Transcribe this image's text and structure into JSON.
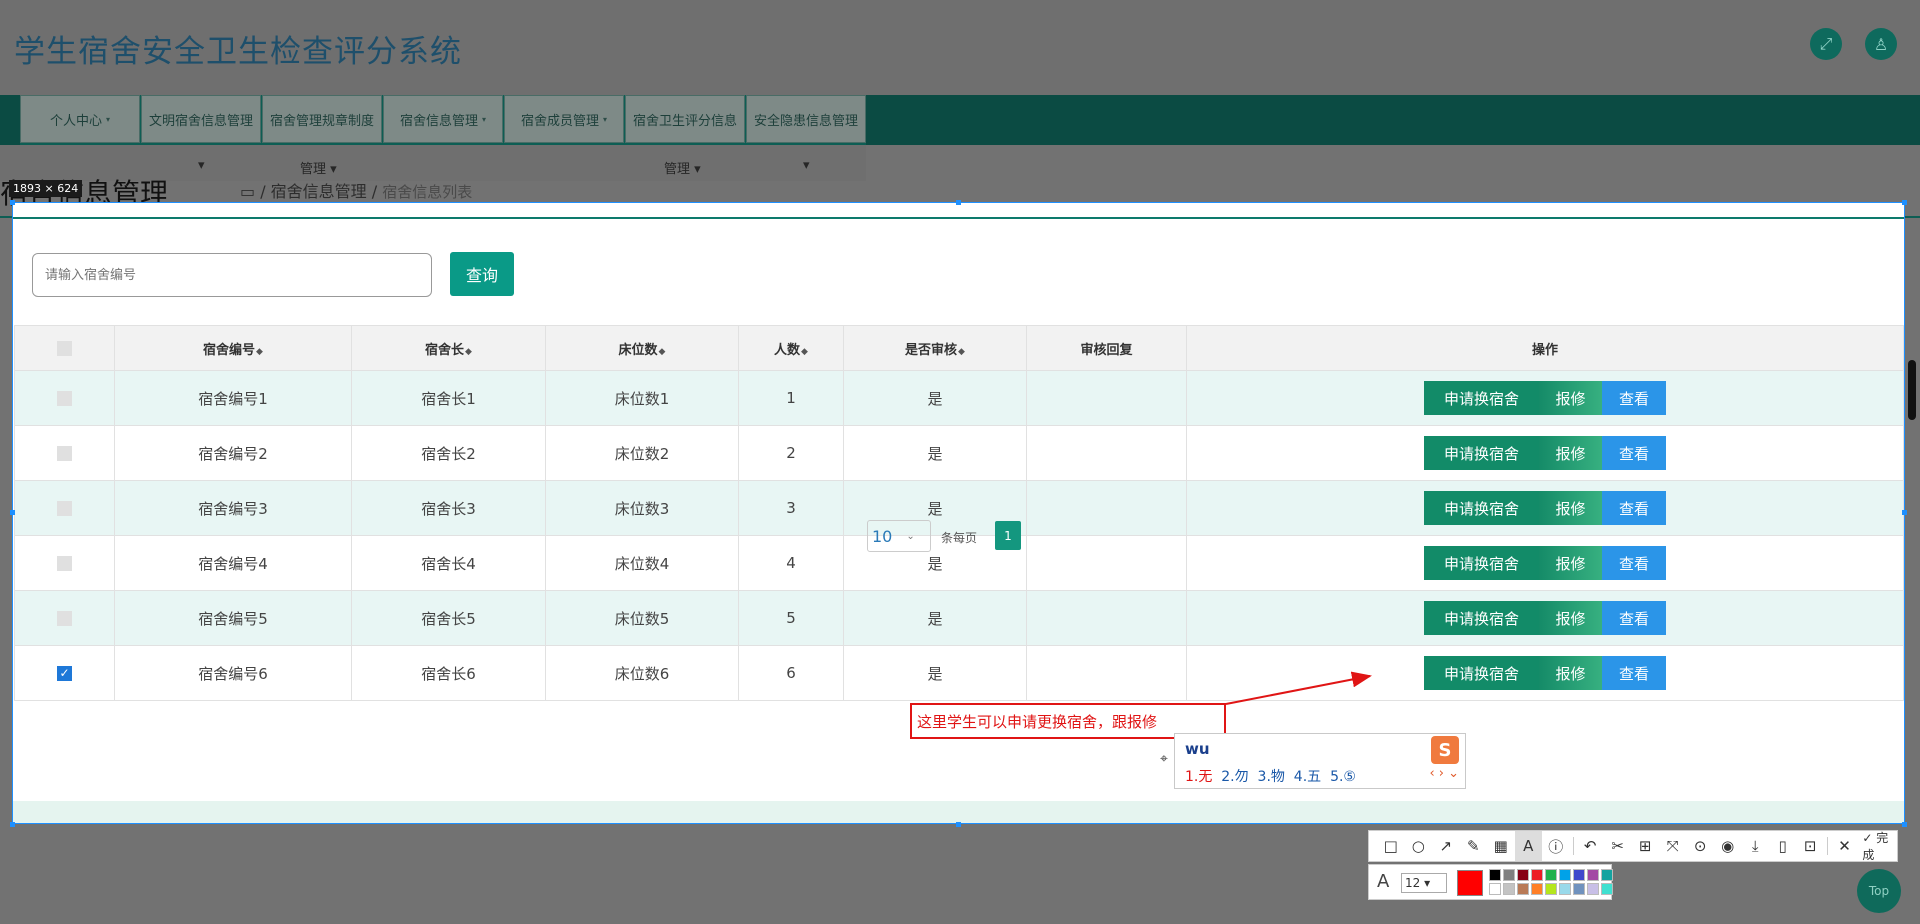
{
  "app": {
    "title": "学生宿舍安全卫生检查评分系统"
  },
  "header_icons": {
    "fullscreen": "⤢",
    "user": "♙"
  },
  "nav": {
    "items": [
      {
        "label": "个人中心",
        "caret": "▾"
      },
      {
        "label": "文明宿舍信息管理",
        "caret": ""
      },
      {
        "label": "宿舍管理规章制度",
        "caret": ""
      },
      {
        "label": "宿舍信息管理",
        "caret": "▾"
      },
      {
        "label": "宿舍成员管理",
        "caret": "▾"
      },
      {
        "label": "宿舍卫生评分信息",
        "caret": ""
      },
      {
        "label": "安全隐患信息管理",
        "caret": ""
      }
    ],
    "sub": [
      {
        "label": "▾"
      },
      {
        "label": "管理 ▾"
      },
      {
        "label": "管理 ▾"
      },
      {
        "label": "▾"
      }
    ]
  },
  "page": {
    "heading": "宿舍信息管理",
    "breadcrumb_mid": "▭ / 宿舍信息管理 / ",
    "breadcrumb_last": "宿舍信息列表"
  },
  "capture": {
    "size_label": "1893 × 624"
  },
  "search": {
    "placeholder": "请输入宿舍编号",
    "button": "查询"
  },
  "table": {
    "headers": [
      "宿舍编号",
      "宿舍长",
      "床位数",
      "人数",
      "是否审核",
      "审核回复",
      "操作"
    ],
    "sort_icon": "◆",
    "rows": [
      {
        "no": "宿舍编号1",
        "leader": "宿舍长1",
        "beds": "床位数1",
        "count": "1",
        "audited": "是",
        "reply": "",
        "checked": false
      },
      {
        "no": "宿舍编号2",
        "leader": "宿舍长2",
        "beds": "床位数2",
        "count": "2",
        "audited": "是",
        "reply": "",
        "checked": false
      },
      {
        "no": "宿舍编号3",
        "leader": "宿舍长3",
        "beds": "床位数3",
        "count": "3",
        "audited": "是",
        "reply": "",
        "checked": false
      },
      {
        "no": "宿舍编号4",
        "leader": "宿舍长4",
        "beds": "床位数4",
        "count": "4",
        "audited": "是",
        "reply": "",
        "checked": false
      },
      {
        "no": "宿舍编号5",
        "leader": "宿舍长5",
        "beds": "床位数5",
        "count": "5",
        "audited": "是",
        "reply": "",
        "checked": false
      },
      {
        "no": "宿舍编号6",
        "leader": "宿舍长6",
        "beds": "床位数6",
        "count": "6",
        "audited": "是",
        "reply": "",
        "checked": true
      }
    ],
    "actions": {
      "change": "申请换宿舍",
      "repair": "报修",
      "view": "查看"
    }
  },
  "pager": {
    "page_size": "10",
    "per_page_text": "条每页",
    "current_page": "1"
  },
  "annotation": {
    "text": "这里学生可以申请更换宿舍，跟报修"
  },
  "ime": {
    "input": "wu",
    "candidates": [
      "1.无",
      "2.勿",
      "3.物",
      "4.五",
      "5.⑤"
    ],
    "logo": "S",
    "nav": "‹ › ⌄"
  },
  "shot_toolbar": {
    "tools": [
      "□",
      "○",
      "↗",
      "✎",
      "▦",
      "A",
      "ⓘ",
      "↶",
      "✂",
      "⊞",
      "⤧",
      "⊙",
      "◉",
      "⤓",
      "▯",
      "⊡",
      "✕"
    ],
    "done": "✓ 完成",
    "font_icon": "A",
    "font_size": "12 ▾",
    "palette": [
      "#000000",
      "#7f7f7f",
      "#880015",
      "#ed1c24",
      "#22b14c",
      "#00a2e8",
      "#3f48cc",
      "#a349a4",
      "#14a3a0",
      "#ffffff",
      "#c3c3c3",
      "#b97a57",
      "#ff7f27",
      "#b5e61d",
      "#99d9ea",
      "#7092be",
      "#c8bfe7",
      "#40e0d0"
    ],
    "current_color": "#ff0000"
  },
  "top_button": "Top"
}
